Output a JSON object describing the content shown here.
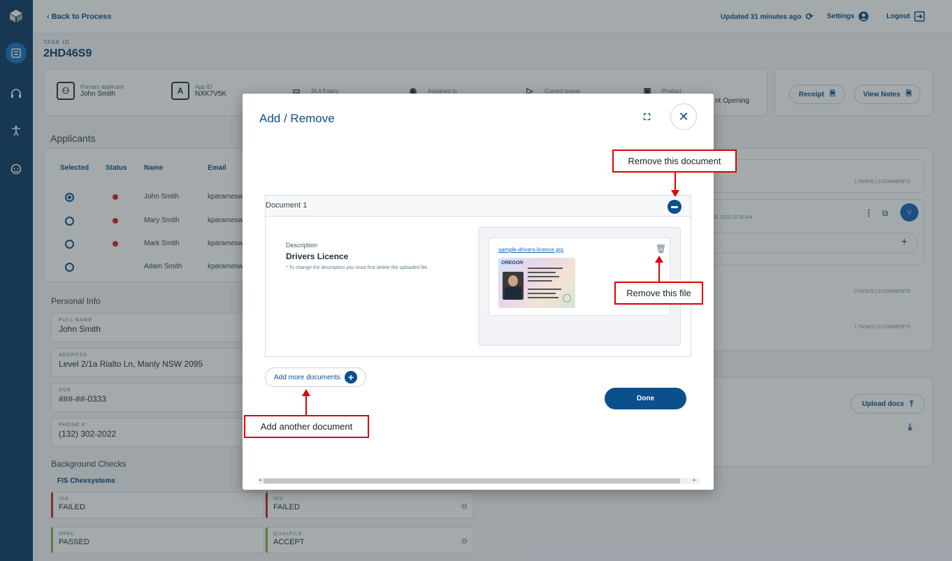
{
  "topbar": {
    "back": "Back to Process",
    "updated": "Updated 31 minutes ago",
    "settings": "Settings",
    "logout": "Logout"
  },
  "task": {
    "id_label": "TASK ID",
    "id": "2HD46S9"
  },
  "info_bar": {
    "primary_label": "Primary applicant",
    "primary_value": "John Smith",
    "appid_label": "App ID",
    "appid_value": "NXK7V5K",
    "sla_label": "SLA Expiry",
    "assigned_label": "Assigned to",
    "queue_label": "Current queue",
    "product_label": "Product",
    "product_value_partial": "nt Opening",
    "receipt": "Receipt",
    "view_notes": "View Notes"
  },
  "applicants": {
    "title": "Applicants",
    "headers": {
      "selected": "Selected",
      "status": "Status",
      "name": "Name",
      "email": "Email"
    },
    "rows": [
      {
        "name": "John Smith",
        "email": "kparamesw",
        "selected": true,
        "flag": true
      },
      {
        "name": "Mary Smith",
        "email": "kparamesw",
        "selected": false,
        "flag": true
      },
      {
        "name": "Mark Smith",
        "email": "kparamesw",
        "selected": false,
        "flag": true
      },
      {
        "name": "Adam Smith",
        "email": "kparamesw",
        "selected": false,
        "flag": false
      }
    ]
  },
  "personal": {
    "title": "Personal Info",
    "full_name_label": "FULL NAME",
    "full_name": "John Smith",
    "address_label": "ADDRESS",
    "address": "Level 2/1a Rialto Ln, Manly NSW 2095",
    "ssn_label": "SSN",
    "ssn": "###-##-0333",
    "phone_label": "PHONE #",
    "phone": "(132) 302-2022"
  },
  "background": {
    "title": "Background Checks",
    "sub": "FIS Chexsystems",
    "ida_label": "IDA",
    "ida": "FAILED",
    "idv_label": "IDV",
    "idv": "FAILED",
    "ofac_label": "OFAC",
    "ofac": "PASSED",
    "qual_label": "QUALFILE",
    "qual": "ACCEPT"
  },
  "tasks_panel": {
    "meta1": "1 TASKS | 0 COMMENTS",
    "date_partial": "JL 2020 11:30 AM",
    "meta2": "0 TASKS | 0 COMMENTS",
    "meta3": "1 TASKS | 0 COMMENTS",
    "upload_docs": "Upload docs"
  },
  "modal": {
    "title": "Add / Remove",
    "doc_title": "Document 1",
    "desc_label": "Description",
    "desc_value": "Drivers Licence",
    "desc_note": "* To change the description you must first delete the uploaded file.",
    "file_name": "sample-drivers-licence.jpg",
    "add_more": "Add more documents",
    "done": "Done"
  },
  "licence_thumb": {
    "state": "OREGON"
  },
  "callouts": {
    "remove_document": "Remove this document",
    "remove_file": "Remove this file",
    "add_document": "Add another document"
  },
  "colors": {
    "brand": "#0b4f8c",
    "rail": "#0d3b66",
    "callout": "#e00000",
    "fail": "#c62828",
    "pass": "#7cb342"
  }
}
